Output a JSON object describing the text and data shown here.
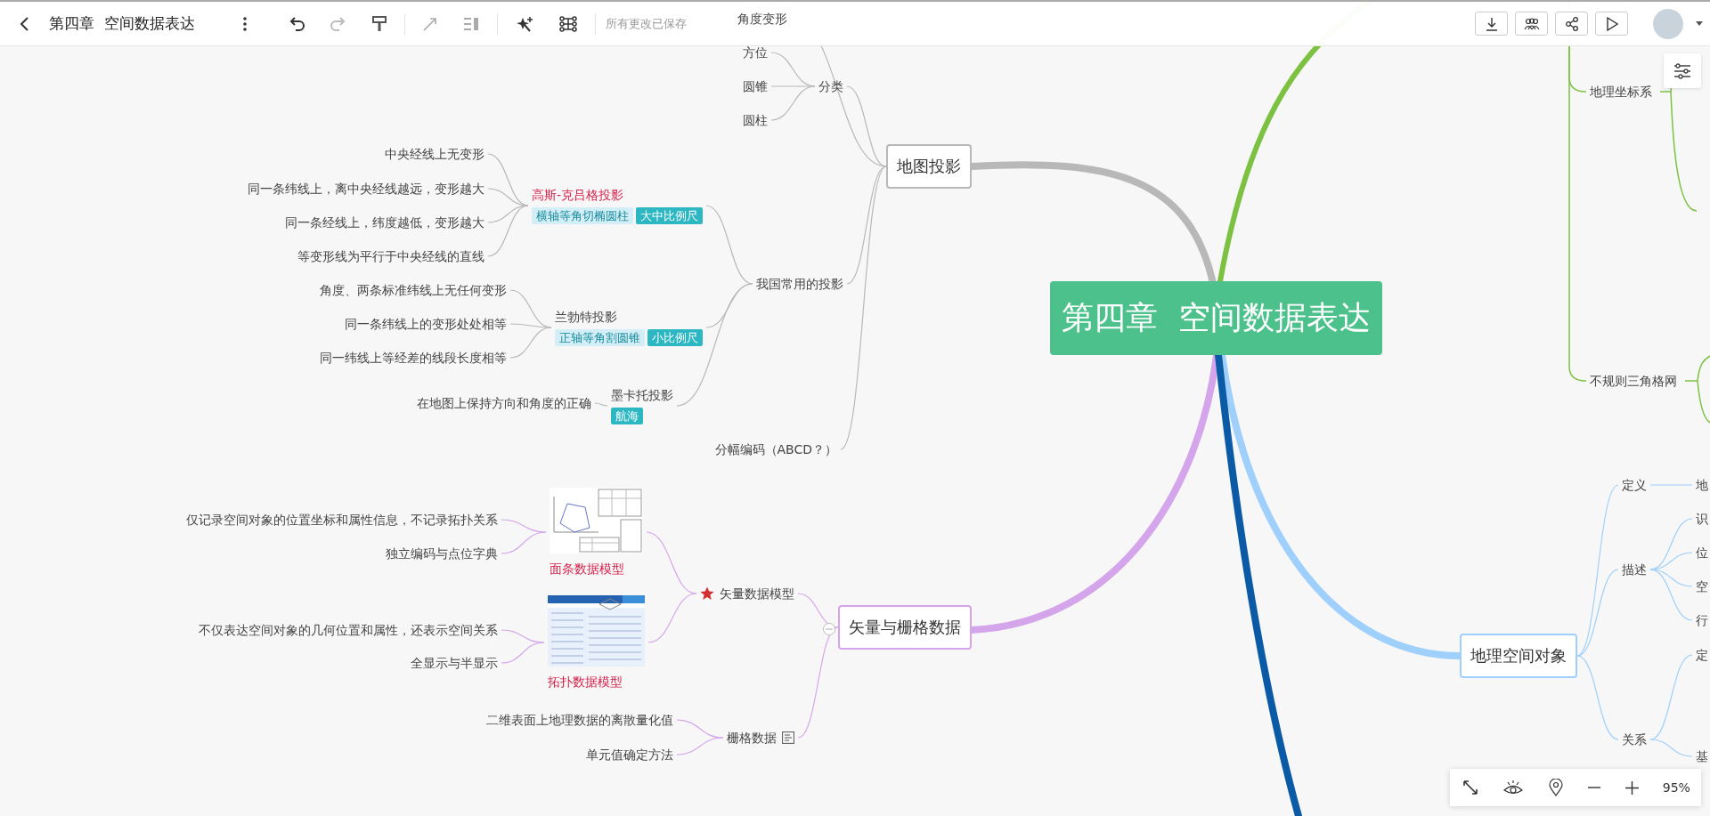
{
  "toolbar": {
    "title": "第四章  空间数据表达",
    "save_status": "所有更改已保存"
  },
  "zoom_bar": {
    "zoom": "95%"
  },
  "mindmap": {
    "central": "第四章  空间数据表达",
    "branches": [
      {
        "label": "地图投影",
        "kind": "box",
        "color": "#b8b8b8",
        "children": [
          {
            "label": "角度变形",
            "kind": "text"
          },
          {
            "label": "分类",
            "kind": "text",
            "children": [
              {
                "label": "方位",
                "kind": "text"
              },
              {
                "label": "圆锥",
                "kind": "text"
              },
              {
                "label": "圆柱",
                "kind": "text"
              }
            ]
          },
          {
            "label": "我国常用的投影",
            "kind": "text",
            "children": [
              {
                "label": "高斯-克吕格投影",
                "kind": "group",
                "emphasis": true,
                "tags": [
                  {
                    "text": "横轴等角切椭圆柱",
                    "kind": "light"
                  },
                  {
                    "text": "大中比例尺",
                    "kind": "solid"
                  }
                ],
                "children": [
                  {
                    "label": "中央经线上无变形",
                    "kind": "text"
                  },
                  {
                    "label": "同一条纬线上，离中央经线越远，变形越大",
                    "kind": "text"
                  },
                  {
                    "label": "同一条经线上，纬度越低，变形越大",
                    "kind": "text"
                  },
                  {
                    "label": "等变形线为平行于中央经线的直线",
                    "kind": "text"
                  }
                ]
              },
              {
                "label": "兰勃特投影",
                "kind": "group",
                "emphasis": false,
                "tags": [
                  {
                    "text": "正轴等角割圆锥",
                    "kind": "light"
                  },
                  {
                    "text": "小比例尺",
                    "kind": "solid"
                  }
                ],
                "children": [
                  {
                    "label": "角度、两条标准纬线上无任何变形",
                    "kind": "text"
                  },
                  {
                    "label": "同一条纬线上的变形处处相等",
                    "kind": "text"
                  },
                  {
                    "label": "同一纬线上等经差的线段长度相等",
                    "kind": "text"
                  }
                ]
              },
              {
                "label": "墨卡托投影",
                "kind": "group",
                "emphasis": false,
                "tags": [
                  {
                    "text": "航海",
                    "kind": "solid"
                  }
                ],
                "children": [
                  {
                    "label": "在地图上保持方向和角度的正确",
                    "kind": "text"
                  }
                ]
              }
            ]
          },
          {
            "label": "分幅编码（ABCD？）",
            "kind": "text"
          }
        ]
      },
      {
        "label": "矢量与栅格数据",
        "kind": "box",
        "color": "#d4a5ea",
        "children": [
          {
            "label": "矢量数据模型",
            "kind": "text",
            "children": [
              {
                "label": "面条数据模型",
                "kind": "image",
                "emphasis": true,
                "children": [
                  {
                    "label": "仅记录空间对象的位置坐标和属性信息，不记录拓扑关系",
                    "kind": "text"
                  },
                  {
                    "label": "独立编码与点位字典",
                    "kind": "text"
                  }
                ]
              },
              {
                "label": "拓扑数据模型",
                "kind": "image",
                "emphasis": true,
                "children": [
                  {
                    "label": "不仅表达空间对象的几何位置和属性，还表示空间关系",
                    "kind": "text"
                  },
                  {
                    "label": "全显示与半显示",
                    "kind": "text"
                  }
                ]
              }
            ]
          },
          {
            "label": "栅格数据",
            "kind": "text",
            "children": [
              {
                "label": "二维表面上地理数据的离散量化值",
                "kind": "text"
              },
              {
                "label": "单元值确定方法",
                "kind": "text"
              }
            ]
          }
        ]
      },
      {
        "label": "地理空间对象",
        "kind": "box",
        "color": "#9fcffb",
        "children": [
          {
            "label": "定义",
            "kind": "text",
            "children": [
              {
                "label": "地",
                "kind": "text"
              }
            ]
          },
          {
            "label": "描述",
            "kind": "text",
            "children": [
              {
                "label": "识",
                "kind": "text"
              },
              {
                "label": "位",
                "kind": "text"
              },
              {
                "label": "空",
                "kind": "text"
              },
              {
                "label": "行",
                "kind": "text"
              }
            ]
          },
          {
            "label": "关系",
            "kind": "text",
            "children": [
              {
                "label": "定",
                "kind": "text"
              },
              {
                "label": "基",
                "kind": "text"
              }
            ]
          }
        ]
      },
      {
        "kind": "offscreen",
        "color": "#7cc142",
        "children": [
          {
            "label": "地理坐标系",
            "kind": "text"
          },
          {
            "label": "不规则三角格网",
            "kind": "text"
          }
        ]
      },
      {
        "kind": "offscreen",
        "color": "#0b5aa6"
      }
    ]
  }
}
